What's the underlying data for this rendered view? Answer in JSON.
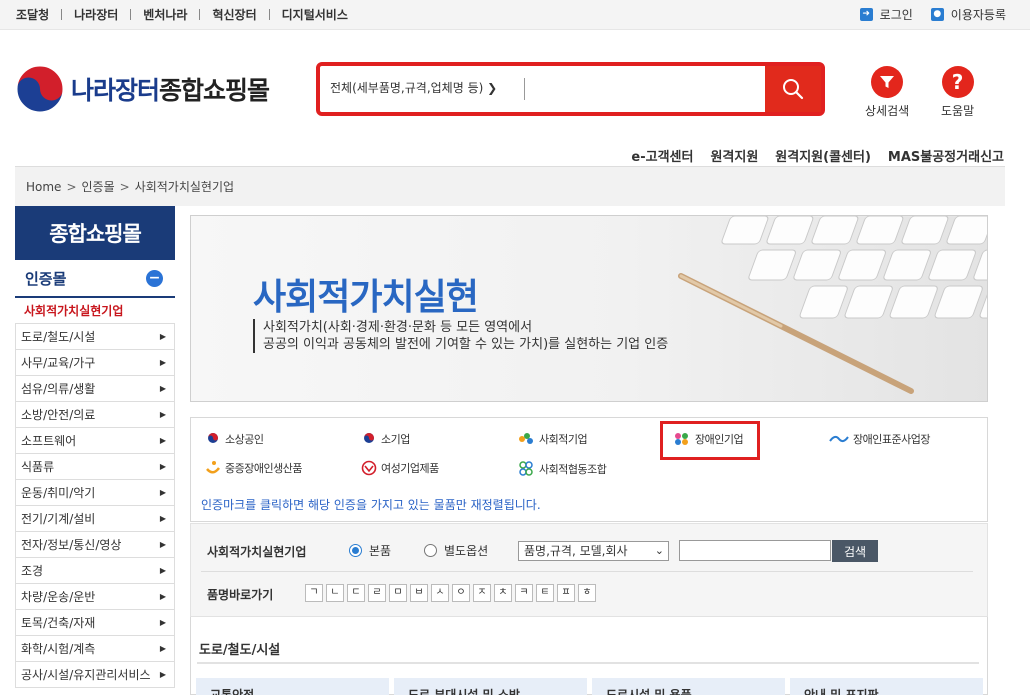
{
  "topbar": {
    "links": [
      "조달청",
      "나라장터",
      "벤처나라",
      "혁신장터",
      "디지털서비스"
    ],
    "login": "로그인",
    "register": "이용자등록"
  },
  "header": {
    "logo_part1": "나라장터",
    "logo_part2": "종합쇼핑몰",
    "search_scope": "전체(세부품명,규격,업체명 등)",
    "search_value": "",
    "detail_search": "상세검색",
    "help": "도움말"
  },
  "service_links": [
    "e-고객센터",
    "원격지원",
    "원격지원(콜센터)",
    "MAS불공정거래신고"
  ],
  "breadcrumb": [
    "Home",
    "인증몰",
    "사회적가치실현기업"
  ],
  "sidebar": {
    "title": "종합쇼핑몰",
    "section": "인증몰",
    "active_item": "사회적가치실현기업",
    "items": [
      "도로/철도/시설",
      "사무/교육/가구",
      "섬유/의류/생활",
      "소방/안전/의료",
      "소프트웨어",
      "식품류",
      "운동/취미/악기",
      "전기/기계/설비",
      "전자/정보/통신/영상",
      "조경",
      "차량/운송/운반",
      "토목/건축/자재",
      "화학/시험/계측",
      "공사/시설/유지관리서비스"
    ]
  },
  "banner": {
    "title": "사회적가치실현",
    "desc_line1": "사회적가치(사회·경제·환경·문화 등 모든 영역에서",
    "desc_line2": "공공의 이익과 공동체의 발전에 기여할 수 있는 가치)를 실현하는 기업 인증"
  },
  "certs": {
    "items": [
      "소상공인",
      "소기업",
      "사회적기업",
      "장애인기업",
      "장애인표준사업장",
      "중증장애인생산품",
      "여성기업제품",
      "사회적협동조합"
    ],
    "note": "인증마크를 클릭하면 해당 인증을 가지고 있는 물품만 재정렬됩니다."
  },
  "filter": {
    "label": "사회적가치실현기업",
    "radio1": "본품",
    "radio2": "별도옵션",
    "select_value": "품명,규격, 모델,회사",
    "keyword": "",
    "search_button": "검색",
    "jamo_label": "품명바로가기",
    "jamo": [
      "ㄱ",
      "ㄴ",
      "ㄷ",
      "ㄹ",
      "ㅁ",
      "ㅂ",
      "ㅅ",
      "ㅇ",
      "ㅈ",
      "ㅊ",
      "ㅋ",
      "ㅌ",
      "ㅍ",
      "ㅎ"
    ]
  },
  "category": {
    "title": "도로/철도/시설",
    "columns": [
      "교통안전",
      "도로 부대시설 및 소방",
      "도로시설 및 용품",
      "안내 및 표지판"
    ]
  },
  "colors": {
    "brand_navy": "#1a3b78",
    "search_red": "#e12a1c",
    "link_blue": "#2a62c6",
    "active_red": "#c8161d"
  }
}
